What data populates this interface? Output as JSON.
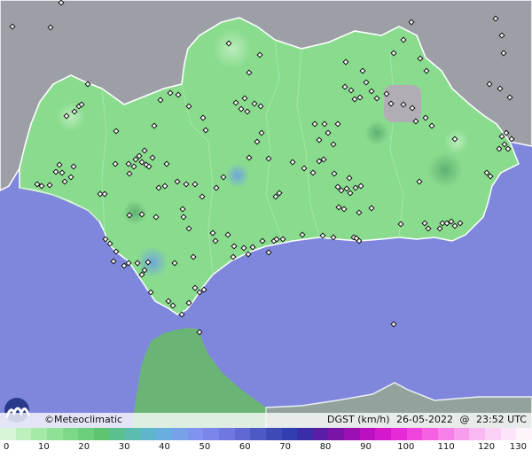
{
  "credit": "©Meteoclimatic",
  "product": {
    "variable": "DGST (km/h)",
    "date": "26-05-2022",
    "at": "@",
    "time": "23:52 UTC"
  },
  "legend": {
    "labels": [
      "0",
      "10",
      "20",
      "30",
      "40",
      "50",
      "60",
      "70",
      "80",
      "90",
      "100",
      "110",
      "120",
      "130"
    ],
    "colors": [
      "#d7f5d7",
      "#bdf0bd",
      "#a5eaa7",
      "#8fe295",
      "#7dd887",
      "#6ccf7b",
      "#5fc470",
      "#5bc090",
      "#5cbcb0",
      "#5fb6cc",
      "#69aee0",
      "#77a2ea",
      "#8094ef",
      "#7b86ea",
      "#6f78e0",
      "#6068d4",
      "#4e58c6",
      "#3e4ab8",
      "#303eb0",
      "#3a2ea8",
      "#5a1ea6",
      "#7a14a8",
      "#9a10b2",
      "#bb10c0",
      "#d418cc",
      "#e62ad6",
      "#f044dc",
      "#f462e2",
      "#f680e8",
      "#f89cee",
      "#f9b8f2",
      "#fad0f6",
      "#fce4fa",
      "#fef4fc"
    ]
  },
  "colors": {
    "sea": "#7f87dc",
    "land_region": "#89dc8e",
    "land_other": "#9c9fa6",
    "north_africa": "#6ab575",
    "border": "#ffffff"
  },
  "stations": [
    [
      14,
      30
    ],
    [
      57,
      31
    ],
    [
      69,
      3
    ],
    [
      258,
      49
    ],
    [
      281,
      82
    ],
    [
      293,
      62
    ],
    [
      390,
      70
    ],
    [
      409,
      80
    ],
    [
      413,
      93
    ],
    [
      444,
      60
    ],
    [
      474,
      66
    ],
    [
      481,
      80
    ],
    [
      84,
      126
    ],
    [
      89,
      120
    ],
    [
      92,
      118
    ],
    [
      75,
      131
    ],
    [
      99,
      95
    ],
    [
      192,
      105
    ],
    [
      201,
      107
    ],
    [
      181,
      113
    ],
    [
      213,
      120
    ],
    [
      229,
      133
    ],
    [
      266,
      116
    ],
    [
      272,
      123
    ],
    [
      276,
      111
    ],
    [
      279,
      126
    ],
    [
      287,
      117
    ],
    [
      294,
      120
    ],
    [
      232,
      147
    ],
    [
      174,
      142
    ],
    [
      131,
      148
    ],
    [
      355,
      140
    ],
    [
      366,
      140
    ],
    [
      381,
      140
    ],
    [
      370,
      150
    ],
    [
      360,
      158
    ],
    [
      376,
      163
    ],
    [
      389,
      98
    ],
    [
      396,
      102
    ],
    [
      400,
      112
    ],
    [
      406,
      110
    ],
    [
      419,
      103
    ],
    [
      425,
      111
    ],
    [
      436,
      106
    ],
    [
      441,
      117
    ],
    [
      455,
      118
    ],
    [
      465,
      122
    ],
    [
      469,
      137
    ],
    [
      480,
      133
    ],
    [
      487,
      142
    ],
    [
      513,
      157
    ],
    [
      563,
      168
    ],
    [
      571,
      150
    ],
    [
      566,
      154
    ],
    [
      569,
      163
    ],
    [
      573,
      168
    ],
    [
      577,
      157
    ],
    [
      564,
      100
    ],
    [
      552,
      95
    ],
    [
      575,
      110
    ],
    [
      566,
      40
    ],
    [
      568,
      60
    ],
    [
      464,
      25
    ],
    [
      455,
      45
    ],
    [
      559,
      21
    ],
    [
      67,
      186
    ],
    [
      70,
      195
    ],
    [
      73,
      205
    ],
    [
      80,
      200
    ],
    [
      83,
      188
    ],
    [
      63,
      194
    ],
    [
      56,
      209
    ],
    [
      42,
      208
    ],
    [
      47,
      210
    ],
    [
      130,
      185
    ],
    [
      145,
      185
    ],
    [
      153,
      180
    ],
    [
      157,
      176
    ],
    [
      160,
      183
    ],
    [
      163,
      170
    ],
    [
      151,
      188
    ],
    [
      146,
      196
    ],
    [
      165,
      186
    ],
    [
      168,
      188
    ],
    [
      172,
      178
    ],
    [
      179,
      212
    ],
    [
      186,
      210
    ],
    [
      188,
      185
    ],
    [
      200,
      205
    ],
    [
      210,
      208
    ],
    [
      220,
      208
    ],
    [
      228,
      222
    ],
    [
      244,
      212
    ],
    [
      252,
      200
    ],
    [
      281,
      178
    ],
    [
      290,
      160
    ],
    [
      295,
      150
    ],
    [
      303,
      179
    ],
    [
      311,
      222
    ],
    [
      315,
      218
    ],
    [
      330,
      183
    ],
    [
      343,
      190
    ],
    [
      353,
      195
    ],
    [
      360,
      182
    ],
    [
      365,
      180
    ],
    [
      377,
      196
    ],
    [
      381,
      211
    ],
    [
      385,
      215
    ],
    [
      391,
      213
    ],
    [
      394,
      201
    ],
    [
      395,
      218
    ],
    [
      401,
      212
    ],
    [
      407,
      210
    ],
    [
      382,
      234
    ],
    [
      388,
      236
    ],
    [
      405,
      240
    ],
    [
      419,
      235
    ],
    [
      479,
      252
    ],
    [
      483,
      258
    ],
    [
      496,
      258
    ],
    [
      499,
      252
    ],
    [
      504,
      252
    ],
    [
      509,
      250
    ],
    [
      513,
      255
    ],
    [
      519,
      252
    ],
    [
      549,
      195
    ],
    [
      553,
      199
    ],
    [
      473,
      205
    ],
    [
      452,
      253
    ],
    [
      113,
      219
    ],
    [
      118,
      219
    ],
    [
      176,
      245
    ],
    [
      160,
      242
    ],
    [
      146,
      243
    ],
    [
      206,
      236
    ],
    [
      207,
      245
    ],
    [
      213,
      258
    ],
    [
      240,
      263
    ],
    [
      243,
      272
    ],
    [
      257,
      265
    ],
    [
      264,
      278
    ],
    [
      263,
      290
    ],
    [
      275,
      280
    ],
    [
      280,
      287
    ],
    [
      285,
      279
    ],
    [
      296,
      272
    ],
    [
      303,
      285
    ],
    [
      309,
      272
    ],
    [
      312,
      270
    ],
    [
      319,
      270
    ],
    [
      341,
      265
    ],
    [
      364,
      266
    ],
    [
      376,
      268
    ],
    [
      399,
      268
    ],
    [
      402,
      269
    ],
    [
      405,
      272
    ],
    [
      119,
      270
    ],
    [
      124,
      275
    ],
    [
      131,
      284
    ],
    [
      128,
      295
    ],
    [
      140,
      300
    ],
    [
      145,
      297
    ],
    [
      155,
      297
    ],
    [
      167,
      296
    ],
    [
      163,
      305
    ],
    [
      160,
      310
    ],
    [
      170,
      330
    ],
    [
      190,
      340
    ],
    [
      197,
      297
    ],
    [
      195,
      345
    ],
    [
      205,
      355
    ],
    [
      213,
      342
    ],
    [
      220,
      325
    ],
    [
      225,
      330
    ],
    [
      230,
      327
    ],
    [
      218,
      290
    ],
    [
      225,
      375
    ],
    [
      444,
      366
    ]
  ]
}
